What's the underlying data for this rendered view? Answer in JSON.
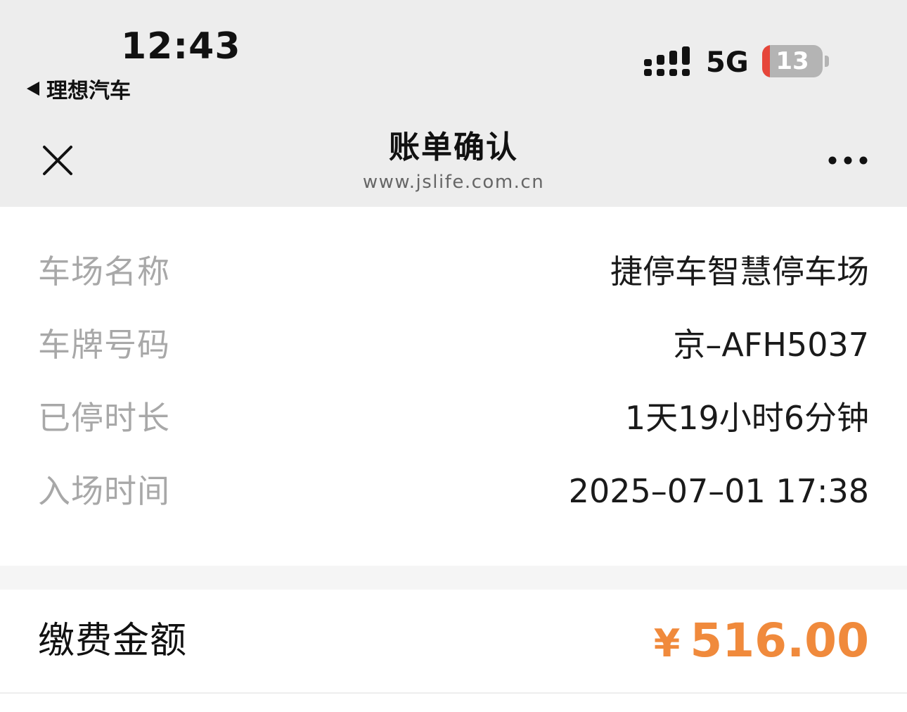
{
  "status_bar": {
    "time": "12:43",
    "back_app": "理想汽车",
    "network": "5G",
    "battery_level": "13",
    "battery_fraction": 0.13,
    "battery_alert_color": "#e6463a"
  },
  "nav": {
    "title": "账单确认",
    "subtitle": "www.jslife.com.cn",
    "close_icon": "close-icon",
    "more_icon": "more-icon"
  },
  "details": [
    {
      "label": "车场名称",
      "value": "捷停车智慧停车场"
    },
    {
      "label": "车牌号码",
      "value": "京–AFH5037"
    },
    {
      "label": "已停时长",
      "value": "1天19小时6分钟"
    },
    {
      "label": "入场时间",
      "value": "2025–07–01 17:38"
    }
  ],
  "payment": {
    "label": "缴费金额",
    "currency": "¥",
    "amount": "516.00",
    "accent_color": "#f08a3c"
  }
}
